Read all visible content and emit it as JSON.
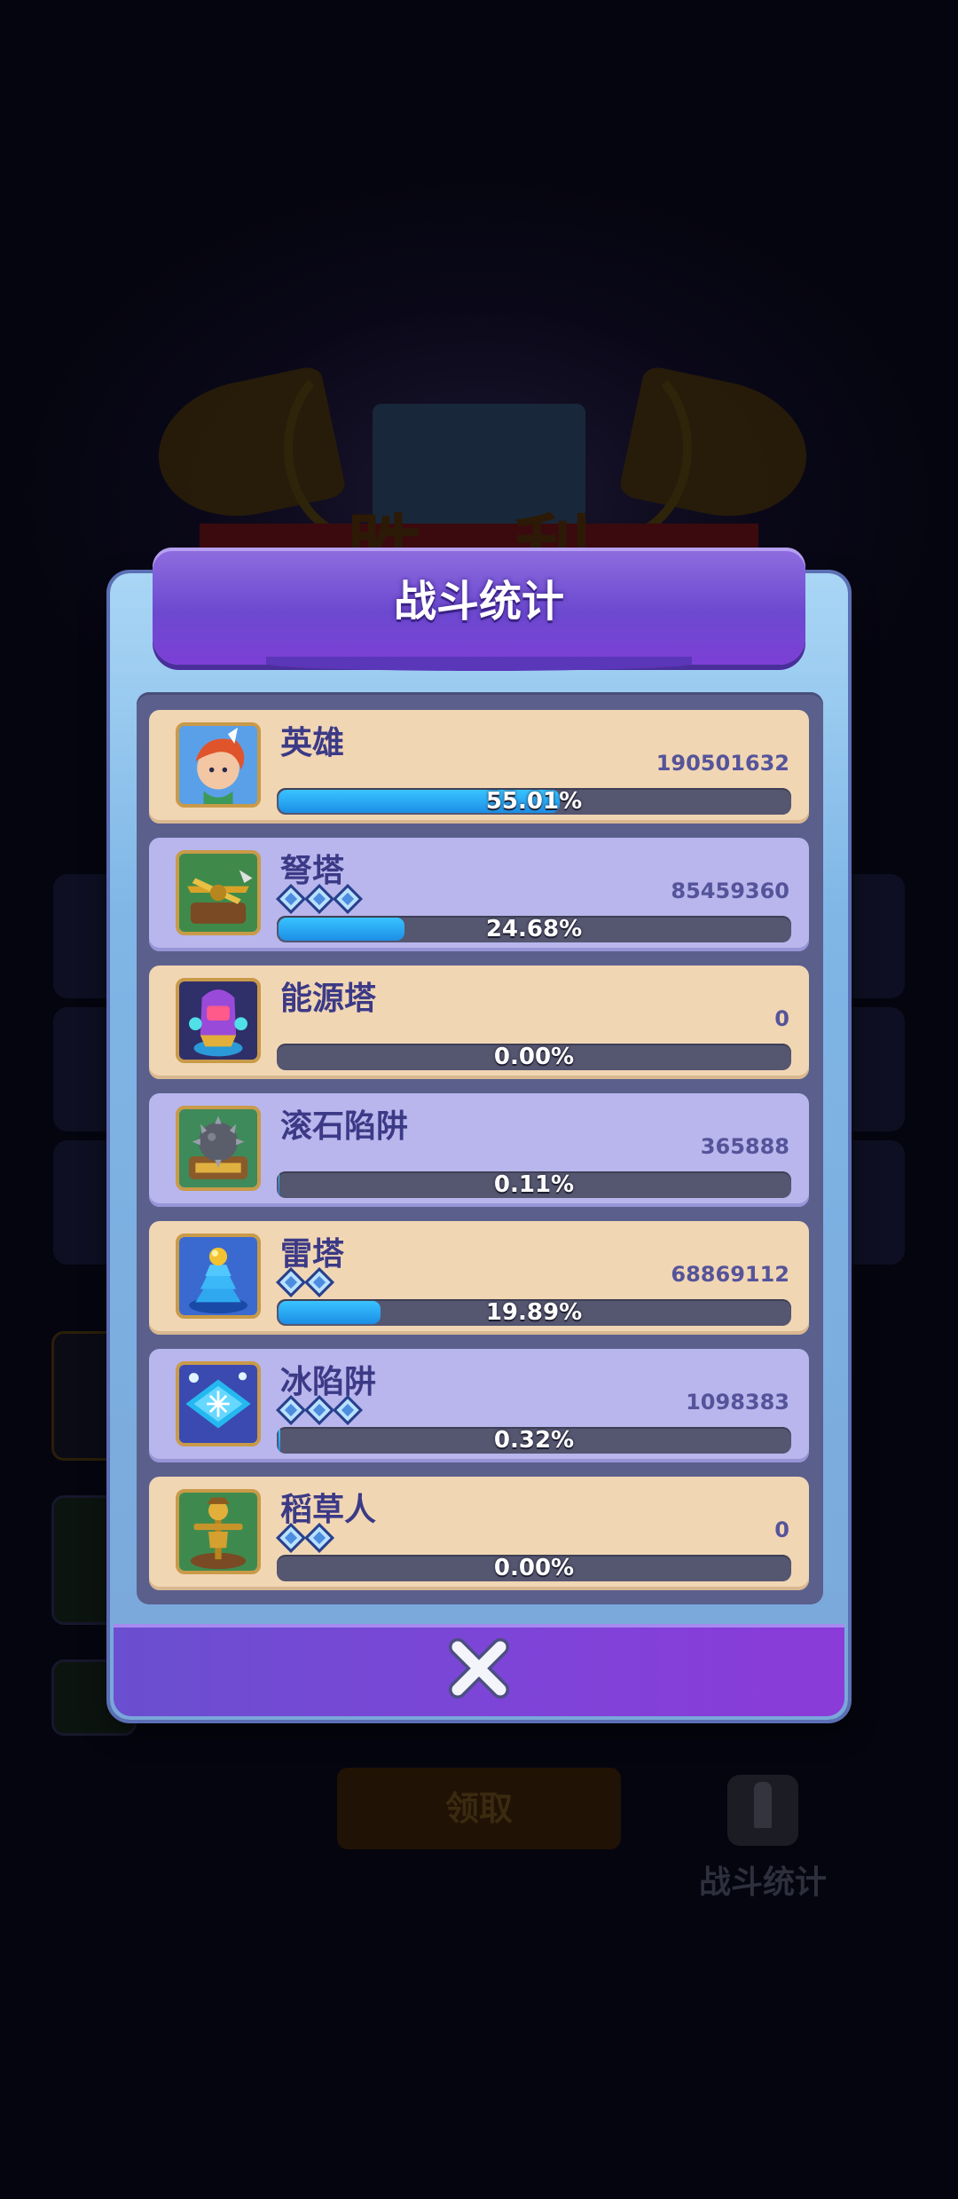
{
  "dialog": {
    "title": "战斗统计"
  },
  "rows": [
    {
      "name": "英雄",
      "stars": 0,
      "damage": "190501632",
      "percent": "55.01%",
      "share": 0.5501,
      "icon": "hero-portrait-icon"
    },
    {
      "name": "弩塔",
      "stars": 3,
      "damage": "85459360",
      "percent": "24.68%",
      "share": 0.2468,
      "icon": "crossbow-tower-icon"
    },
    {
      "name": "能源塔",
      "stars": 0,
      "damage": "0",
      "percent": "0.00%",
      "share": 0.0,
      "icon": "energy-tower-icon"
    },
    {
      "name": "滚石陷阱",
      "stars": 0,
      "damage": "365888",
      "percent": "0.11%",
      "share": 0.0011,
      "icon": "rolling-stone-trap-icon"
    },
    {
      "name": "雷塔",
      "stars": 2,
      "damage": "68869112",
      "percent": "19.89%",
      "share": 0.1989,
      "icon": "thunder-tower-icon"
    },
    {
      "name": "冰陷阱",
      "stars": 3,
      "damage": "1098383",
      "percent": "0.32%",
      "share": 0.0032,
      "icon": "ice-trap-icon"
    },
    {
      "name": "稻草人",
      "stars": 2,
      "damage": "0",
      "percent": "0.00%",
      "share": 0.0,
      "icon": "scarecrow-icon"
    }
  ],
  "background": {
    "victory_title_left": "胜",
    "victory_title_right": "利",
    "claim_label": "领取",
    "stats_label": "战斗统计"
  },
  "colors": {
    "accent_purple": "#7c4fd8",
    "bar_fill": "#29a8f4",
    "row_light": "#f1d6b4",
    "row_lavender": "#b8b6ec",
    "name_text": "#3c3a86"
  },
  "close_icon": "close-icon"
}
